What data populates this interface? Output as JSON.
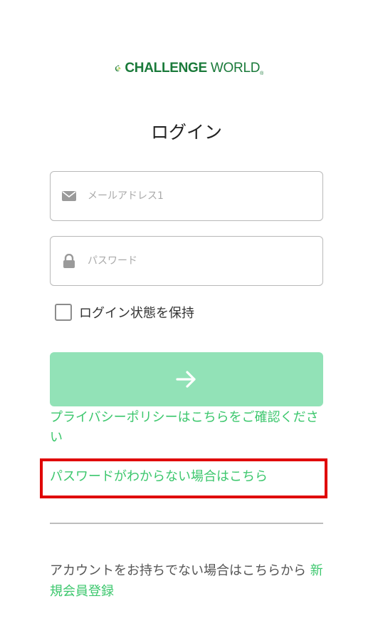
{
  "logo": {
    "text_bold": "CHALLENGE",
    "text_light": "WORLD",
    "registered_mark": "®"
  },
  "title": "ログイン",
  "email_field": {
    "placeholder": "メールアドレス1",
    "value": "",
    "icon": "envelope-icon"
  },
  "password_field": {
    "placeholder": "パスワード",
    "value": "",
    "icon": "lock-icon"
  },
  "remember": {
    "label": "ログイン状態を保持",
    "checked": false
  },
  "submit": {
    "icon": "arrow-right-icon"
  },
  "privacy_link": "プライバシーポリシーはこちらをご確認ください",
  "forgot_password_link": "パスワードがわからない場合はこちら",
  "signup": {
    "text": "アカウントをお持ちでない場合はこちらから ",
    "link": "新規会員登録"
  },
  "colors": {
    "accent_green": "#3cc76d",
    "button_green": "#92e2b7",
    "logo_green": "#1a7a3a",
    "logo_lime": "#a6c83a",
    "highlight_red": "#e00000"
  }
}
